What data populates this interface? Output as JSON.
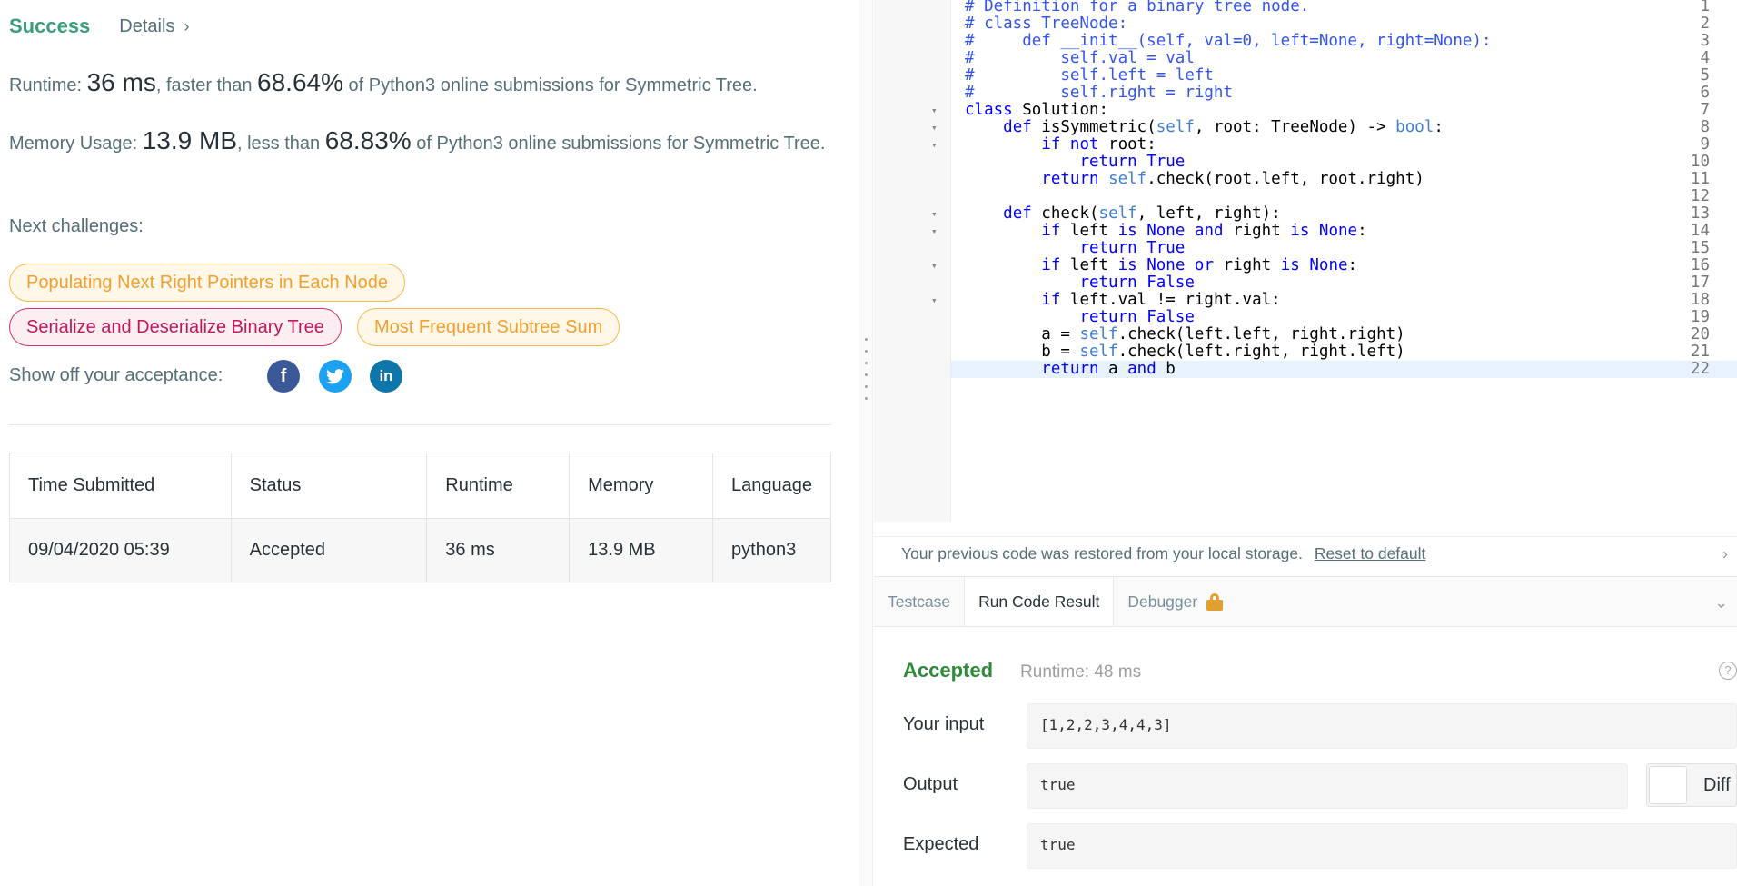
{
  "left": {
    "status": "Success",
    "details_label": "Details",
    "runtime": {
      "label": "Runtime: ",
      "value": "36 ms",
      "mid": ", faster than ",
      "pct": "68.64%",
      "suffix": " of Python3 online submissions for Symmetric Tree."
    },
    "memory": {
      "label": "Memory Usage: ",
      "value": "13.9 MB",
      "mid": ", less than ",
      "pct": "68.83%",
      "suffix": " of Python3 online submissions for Symmetric Tree."
    },
    "next_label": "Next challenges:",
    "challenges": [
      "Populating Next Right Pointers in Each Node",
      "Serialize and Deserialize Binary Tree",
      "Most Frequent Subtree Sum"
    ],
    "share_label": "Show off your acceptance:",
    "table": {
      "headers": [
        "Time Submitted",
        "Status",
        "Runtime",
        "Memory",
        "Language"
      ],
      "rows": [
        [
          "09/04/2020 05:39",
          "Accepted",
          "36 ms",
          "13.9 MB",
          "python3"
        ]
      ]
    }
  },
  "editor": {
    "lines": [
      "# Definition for a binary tree node.",
      "# class TreeNode:",
      "#     def __init__(self, val=0, left=None, right=None):",
      "#         self.val = val",
      "#         self.left = left",
      "#         self.right = right",
      "class Solution:",
      "    def isSymmetric(self, root: TreeNode) -> bool:",
      "        if not root:",
      "            return True",
      "        return self.check(root.left, root.right)",
      "",
      "    def check(self, left, right):",
      "        if left is None and right is None:",
      "            return True",
      "        if left is None or right is None:",
      "            return False",
      "        if left.val != right.val:",
      "            return False",
      "        a = self.check(left.left, right.right)",
      "        b = self.check(left.right, right.left)",
      "        return a and b"
    ]
  },
  "console": {
    "notice": "Your previous code was restored from your local storage.",
    "reset_label": "Reset to default",
    "tabs": [
      "Testcase",
      "Run Code Result",
      "Debugger"
    ],
    "result_status": "Accepted",
    "result_runtime": "Runtime: 48 ms",
    "input_label": "Your input",
    "input_value": "[1,2,2,3,4,4,3]",
    "output_label": "Output",
    "output_value": "true",
    "expected_label": "Expected",
    "expected_value": "true",
    "diff_label": "Diff"
  }
}
